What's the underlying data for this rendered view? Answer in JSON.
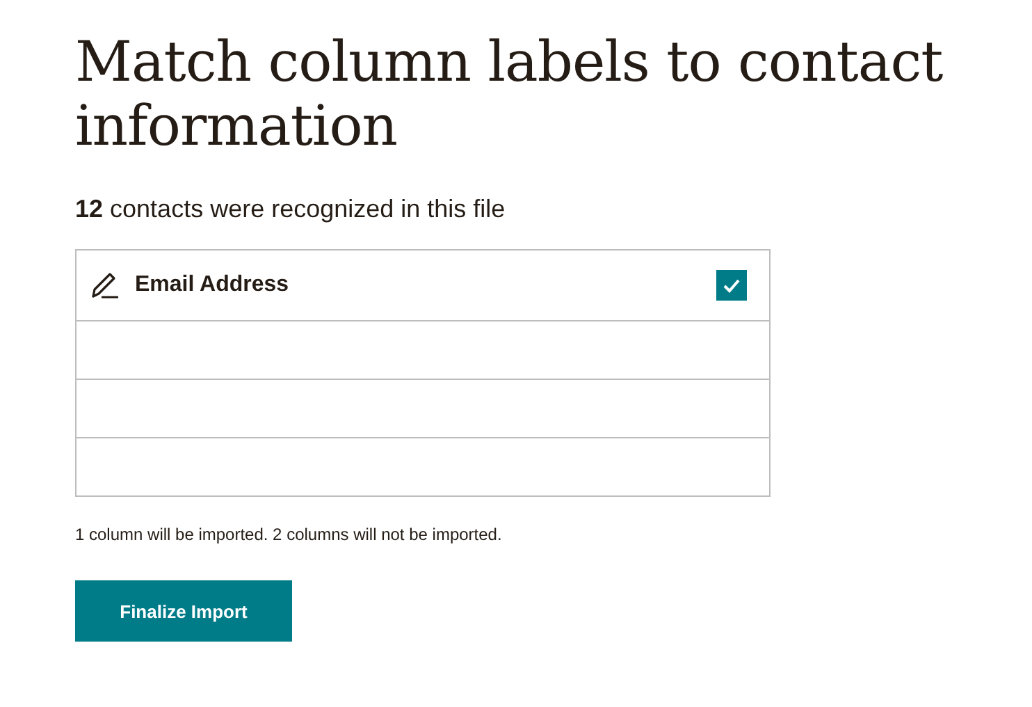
{
  "heading": "Match column labels to contact information",
  "summary": "**12** contacts were recognized in this file",
  "rows": [
    {
      "kind": "column",
      "label": "Email Address",
      "checked": true
    },
    {
      "kind": "empty"
    },
    {
      "kind": "empty"
    },
    {
      "kind": "empty"
    }
  ],
  "note": "1 column will be imported. 2 columns will not be imported.",
  "button": "Finalize Import"
}
